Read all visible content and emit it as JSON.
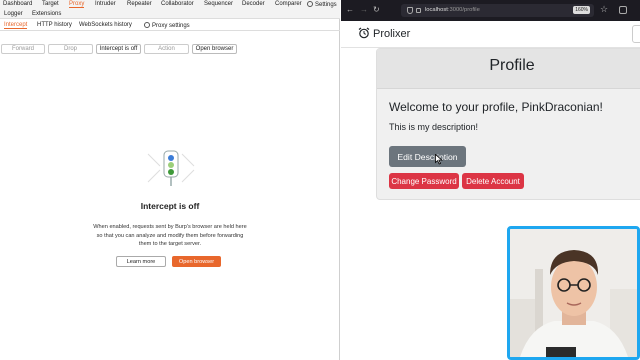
{
  "burp": {
    "menu": [
      "Dashboard",
      "Target",
      "Proxy",
      "Intruder",
      "Repeater",
      "Collaborator",
      "Sequencer",
      "Decoder",
      "Comparer",
      "Settings"
    ],
    "menu_row2": [
      "Logger",
      "Extensions"
    ],
    "subtabs": [
      "Intercept",
      "HTTP history",
      "WebSockets history",
      "Proxy settings"
    ],
    "toolbar": {
      "forward": "Forward",
      "drop": "Drop",
      "intercept": "Intercept is off",
      "action": "Action",
      "open_browser": "Open browser"
    },
    "intercept_title": "Intercept is off",
    "intercept_desc": "When enabled, requests sent by Burp's browser are held here so that you can analyze and modify them before forwarding them to the target server.",
    "learn_more": "Learn more",
    "open_browser": "Open browser",
    "accent": "#e8672c"
  },
  "browser": {
    "url_host": "localhost",
    "url_path": ":3000/profile",
    "zoom": "160%"
  },
  "app": {
    "brand": "Prolixer",
    "card_title": "Profile",
    "welcome": "Welcome to your profile, PinkDraconian!",
    "description": "This is my description!",
    "edit_button": "Edit Description",
    "change_password_button": "Change Password",
    "delete_account_button": "Delete Account",
    "colors": {
      "secondary": "#6c757d",
      "danger": "#dc3545"
    }
  }
}
